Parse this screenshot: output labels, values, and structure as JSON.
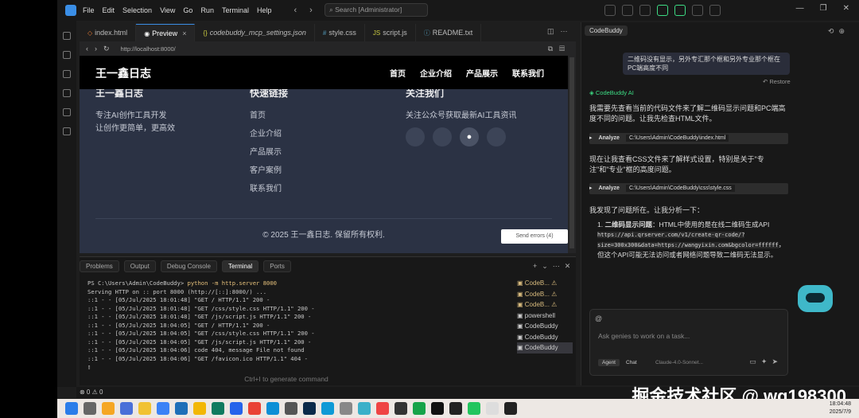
{
  "titlebar": {
    "menu": [
      "File",
      "Edit",
      "Selection",
      "View",
      "Go",
      "Run",
      "Terminal",
      "Help"
    ],
    "search_placeholder": "Search [Administrator]"
  },
  "editor_tabs": [
    {
      "label": "index.html",
      "icon": "html-file-icon"
    },
    {
      "label": "Preview",
      "icon": "eye-icon",
      "active": true
    },
    {
      "label": "codebuddy_mcp_settings.json",
      "icon": "json-file-icon"
    },
    {
      "label": "style.css",
      "icon": "css-file-icon"
    },
    {
      "label": "script.js",
      "icon": "js-file-icon"
    },
    {
      "label": "README.txt",
      "icon": "info-icon"
    }
  ],
  "browser": {
    "url": "http://localhost:8000/"
  },
  "site": {
    "logo": "王一鑫日志",
    "nav": [
      "首页",
      "企业介绍",
      "产品展示",
      "联系我们"
    ],
    "footer_about_title": "王一鑫日志",
    "footer_about_text_1": "专注AI创作工具开发",
    "footer_about_text_2": "让创作更简单，更高效",
    "footer_links_title": "快速链接",
    "footer_links": [
      "首页",
      "企业介绍",
      "产品展示",
      "客户案例",
      "联系我们"
    ],
    "footer_follow_title": "关注我们",
    "footer_follow_text": "关注公众号获取最新AI工具资讯",
    "copyright": "© 2025 王一鑫日志. 保留所有权利."
  },
  "send_errors": "Send errors (4)",
  "panel": {
    "tabs": [
      "Problems",
      "Output",
      "Debug Console",
      "Terminal",
      "Ports"
    ],
    "active_tab": "Terminal",
    "prompt": "PS C:\\Users\\Admin\\CodeBuddy> ",
    "command": "python -m http.server 8000",
    "log": [
      "Serving HTTP on :: port 8000 (http://[::]:8000/) ...",
      "::1 - - [05/Jul/2025 18:01:48] \"GET / HTTP/1.1\" 200 -",
      "::1 - - [05/Jul/2025 18:01:48] \"GET /css/style.css HTTP/1.1\" 200 -",
      "::1 - - [05/Jul/2025 18:01:48] \"GET /js/script.js HTTP/1.1\" 200 -",
      "::1 - - [05/Jul/2025 18:04:05] \"GET / HTTP/1.1\" 200 -",
      "::1 - - [05/Jul/2025 18:04:05] \"GET /css/style.css HTTP/1.1\" 200 -",
      "::1 - - [05/Jul/2025 18:04:05] \"GET /js/script.js HTTP/1.1\" 200 -",
      "::1 - - [05/Jul/2025 18:04:06] code 404, message File not found",
      "::1 - - [05/Jul/2025 18:04:06] \"GET /favicon.ico HTTP/1.1\" 404 -"
    ],
    "terminals": [
      "CodeB...",
      "CodeB...",
      "CodeB...",
      "powershell",
      "CodeBuddy",
      "CodeBuddy",
      "CodeBuddy"
    ],
    "hint": "Ctrl+I to generate command"
  },
  "status": {
    "text": "⊗ 0 ⚠ 0"
  },
  "chat": {
    "tab": "CodeBuddy",
    "user_message": "二维码没有显示，另外专汇那个框和另外专业那个框在PC端高度不同",
    "restore": "Restore",
    "bot_name": "CodeBuddy AI",
    "p1": "我需要先查看当前的代码文件来了解二维码显示问题和PC端高度不同的问题。让我先检查HTML文件。",
    "tool1_label": "Analyze",
    "tool1_path": "C:\\Users\\Admin\\CodeBuddy\\index.html",
    "p2": "现在让我查看CSS文件来了解样式设置，特别是关于\"专注\"和\"专业\"框的高度问题。",
    "tool2_label": "Analyze",
    "tool2_path": "C:\\Users\\Admin\\CodeBuddy\\css\\style.css",
    "p3": "我发现了问题所在。让我分析一下：",
    "item1_title": "二维码显示问题",
    "item1_text_a": "：HTML中使用的是在线二维码生成API ",
    "item1_code": "https://api.qrserver.com/v1/create-qr-code/?size=300x300&data=https://wangyixin.com&bgcolor=ffffff",
    "item1_text_b": "，但这个API可能无法访问或者网络问题导致二维码无法显示。",
    "input_placeholder": "Ask genies to work on a task...",
    "mode_agent": "Agent",
    "mode_chat": "Chat",
    "model": "Claude-4.0-Sonnet..."
  },
  "watermark": "掘金技术社区 @ wg198300",
  "taskbar": {
    "time": "18:04:48",
    "date": "2025/7/9"
  }
}
